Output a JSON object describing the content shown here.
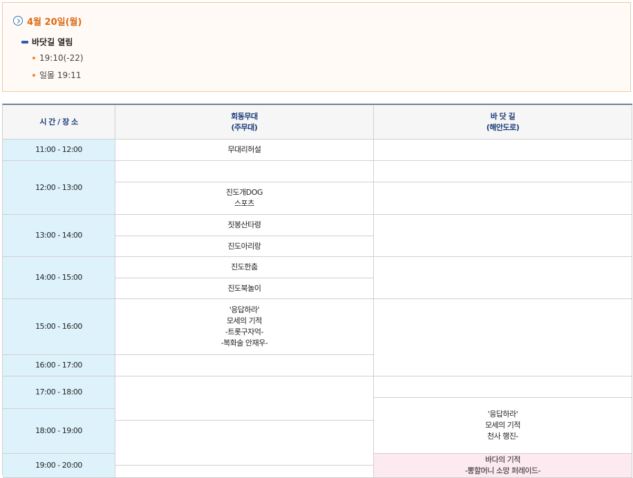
{
  "info": {
    "date": "4월 20일(월)",
    "event": "바닷길 열림",
    "details": [
      "19:10(-22)",
      "일몰 19:11"
    ]
  },
  "table": {
    "headers": {
      "time": "시 간 / 장 소",
      "stage": "회동무대\n(주무대)",
      "road": "바 닷 길\n(해안도로)"
    },
    "times": [
      "11:00 - 12:00",
      "12:00 - 13:00",
      "13:00 - 14:00",
      "14:00 - 15:00",
      "15:00 - 16:00",
      "16:00 - 17:00",
      "17:00 - 18:00",
      "18:00 - 19:00",
      "19:00 - 20:00"
    ],
    "stage_programs": [
      "무대리허설",
      "",
      "진도개DOG\n스포츠",
      "짓봉산타령",
      "진도아리랑",
      "진도한춤",
      "진도북놀이",
      "'응답하라'\n모세의 기적\n-트롯구자억-\n-복화술 안재우-",
      "",
      "",
      "",
      ""
    ],
    "road_programs": [
      "",
      "",
      "",
      "",
      "",
      "",
      "",
      "'응답하라'\n모세의 기적\n천사 행진-",
      "바다의 기적\n-뽕할머니 소망 퍼레이드-"
    ]
  }
}
